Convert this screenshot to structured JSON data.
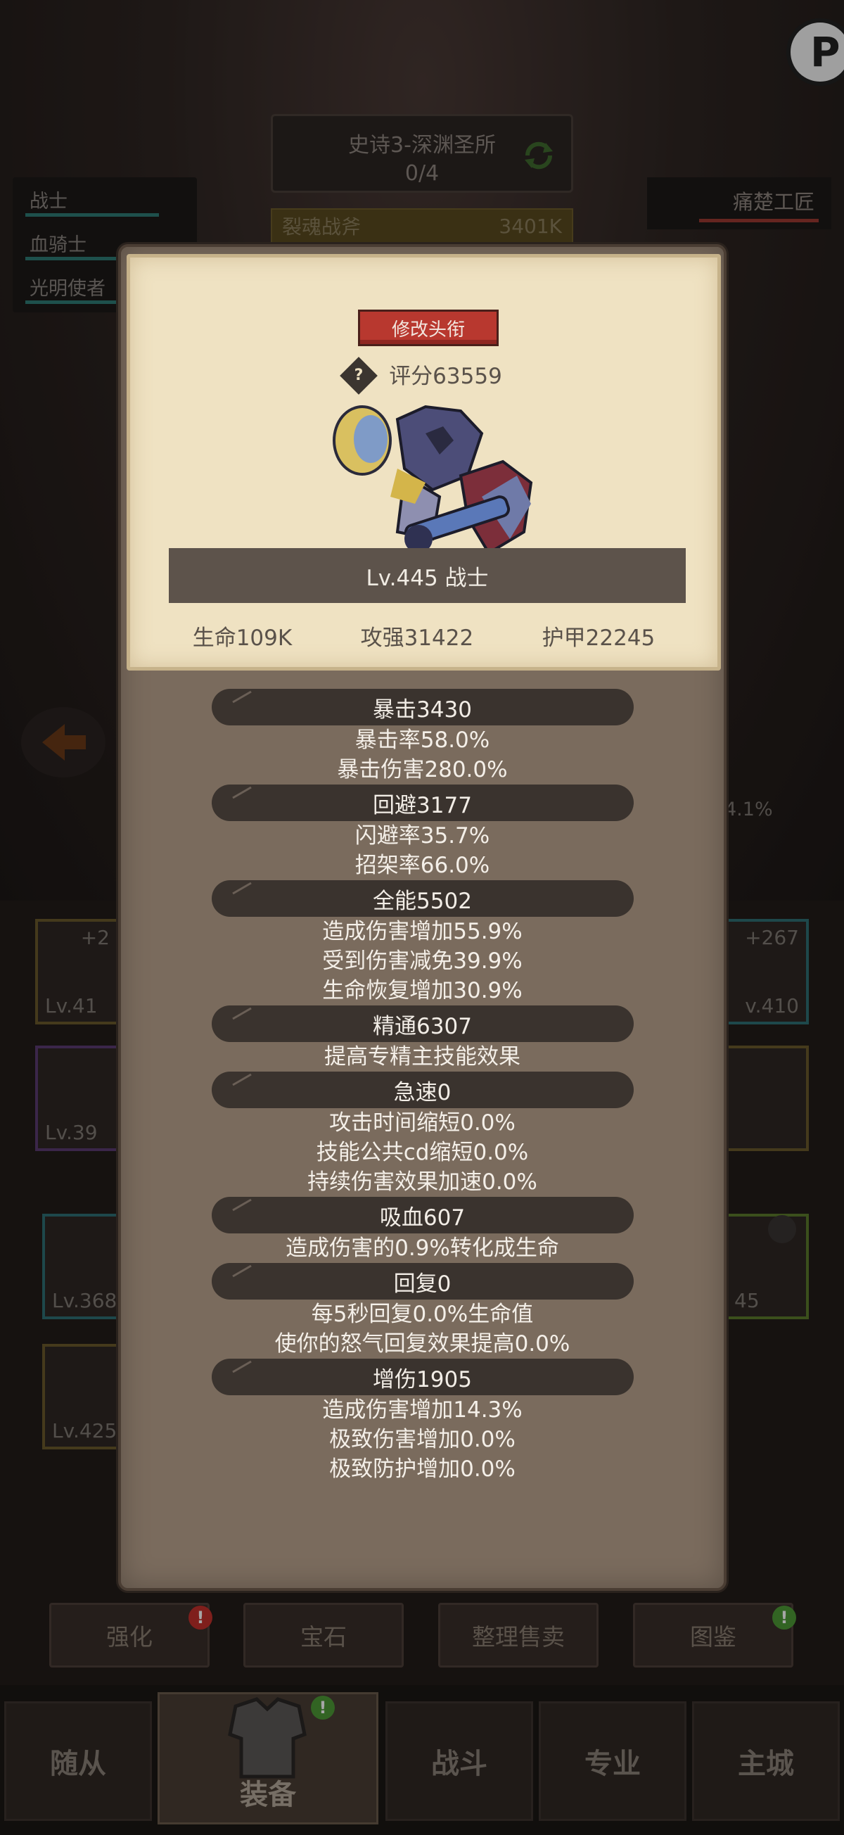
{
  "background": {
    "dungeon_name": "史诗3-深渊圣所",
    "dungeon_progress": "0/4",
    "boss_name": "裂魂战斧",
    "boss_value": "3401K",
    "classes": [
      "战士",
      "血骑士",
      "光明使者"
    ],
    "enemy_name": "痛楚工匠",
    "stat_pct": "4.1%",
    "equip_left": [
      {
        "plus": "+2",
        "level": "Lv.41"
      },
      {
        "plus": "",
        "level": "Lv.39"
      },
      {
        "plus": "",
        "level": "Lv.368"
      },
      {
        "plus": "",
        "level": "Lv.425"
      }
    ],
    "equip_right": [
      {
        "plus": "+267",
        "level": "v.410"
      },
      {
        "plus": "",
        "level": ""
      },
      {
        "plus": "",
        "level": "45"
      }
    ]
  },
  "modal": {
    "rename_button": "修改头衔",
    "help_icon_label": "?",
    "score": "评分63559",
    "level_class": "Lv.445 战士",
    "main_stats": [
      "生命109K",
      "攻强31422",
      "护甲22245"
    ],
    "attributes": [
      {
        "header": "暴击3430",
        "lines": [
          "暴击率58.0%",
          "暴击伤害280.0%"
        ]
      },
      {
        "header": "回避3177",
        "lines": [
          "闪避率35.7%",
          "招架率66.0%"
        ]
      },
      {
        "header": "全能5502",
        "lines": [
          "造成伤害增加55.9%",
          "受到伤害减免39.9%",
          "生命恢复增加30.9%"
        ]
      },
      {
        "header": "精通6307",
        "lines": [
          "提高专精主技能效果"
        ]
      },
      {
        "header": "急速0",
        "lines": [
          "攻击时间缩短0.0%",
          "技能公共cd缩短0.0%",
          "持续伤害效果加速0.0%"
        ]
      },
      {
        "header": "吸血607",
        "lines": [
          "造成伤害的0.9%转化成生命"
        ]
      },
      {
        "header": "回复0",
        "lines": [
          "每5秒回复0.0%生命值",
          "使你的怒气回复效果提高0.0%"
        ]
      },
      {
        "header": "增伤1905",
        "lines": [
          "造成伤害增加14.3%",
          "极致伤害增加0.0%",
          "极致防护增加0.0%"
        ]
      }
    ]
  },
  "actions": {
    "strengthen": "强化",
    "gem": "宝石",
    "sort_sell": "整理售卖",
    "codex": "图鉴",
    "badge_alert": "!"
  },
  "nav": {
    "followers": "随从",
    "equipment": "装备",
    "battle": "战斗",
    "profession": "专业",
    "main_city": "主城"
  },
  "corner_logo": "P"
}
